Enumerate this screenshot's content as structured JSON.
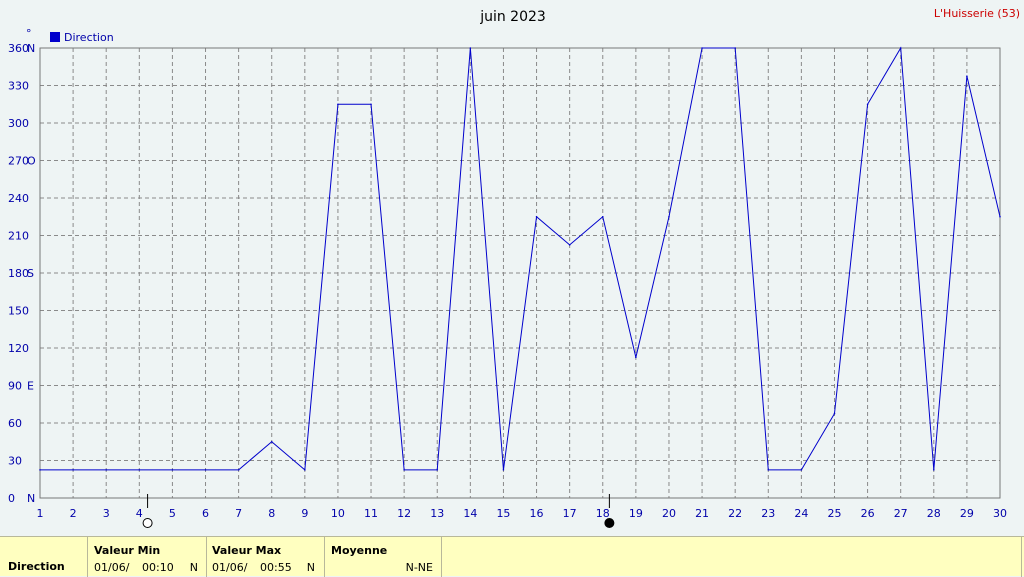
{
  "header": {
    "title": "juin 2023",
    "station": "L'Huisserie (53)",
    "unit_symbol": "°"
  },
  "colors": {
    "line": "#0000cc",
    "axis_text": "#0000aa",
    "title_text": "#000000",
    "station_text": "#cc0000",
    "grid": "#8a8a8a",
    "plot_background": "#eef4f4",
    "footer_background": "#ffffc0"
  },
  "chart_data": {
    "type": "line",
    "title": "juin 2023",
    "xlabel": "",
    "ylabel": "°",
    "xlim": [
      1,
      30
    ],
    "ylim": [
      0,
      360
    ],
    "grid": true,
    "legend_position": "top-left",
    "x_ticks": [
      "1",
      "2",
      "3",
      "4",
      "5",
      "6",
      "7",
      "8",
      "9",
      "10",
      "11",
      "12",
      "13",
      "14",
      "15",
      "16",
      "17",
      "18",
      "19",
      "20",
      "21",
      "22",
      "23",
      "24",
      "25",
      "26",
      "27",
      "28",
      "29",
      "30"
    ],
    "y_ticks": [
      {
        "value": 0,
        "label": "0",
        "cardinal": "N"
      },
      {
        "value": 30,
        "label": "30",
        "cardinal": ""
      },
      {
        "value": 60,
        "label": "60",
        "cardinal": ""
      },
      {
        "value": 90,
        "label": "90",
        "cardinal": "E"
      },
      {
        "value": 120,
        "label": "120",
        "cardinal": ""
      },
      {
        "value": 150,
        "label": "150",
        "cardinal": ""
      },
      {
        "value": 180,
        "label": "180",
        "cardinal": "S"
      },
      {
        "value": 210,
        "label": "210",
        "cardinal": ""
      },
      {
        "value": 240,
        "label": "240",
        "cardinal": ""
      },
      {
        "value": 270,
        "label": "270",
        "cardinal": "O"
      },
      {
        "value": 300,
        "label": "300",
        "cardinal": ""
      },
      {
        "value": 330,
        "label": "330",
        "cardinal": ""
      },
      {
        "value": 360,
        "label": "360",
        "cardinal": "N"
      }
    ],
    "series": [
      {
        "name": "Direction",
        "x": [
          1,
          2,
          3,
          4,
          5,
          6,
          7,
          8,
          9,
          10,
          11,
          12,
          13,
          14,
          15,
          16,
          17,
          18,
          19,
          20,
          21,
          22,
          23,
          24,
          25,
          26,
          27,
          28,
          29,
          30
        ],
        "values": [
          22.5,
          22.5,
          22.5,
          22.5,
          22.5,
          22.5,
          22.5,
          45,
          22.5,
          315,
          315,
          22.5,
          22.5,
          360,
          22.5,
          225,
          202.5,
          225,
          112.5,
          225,
          360,
          360,
          22.5,
          22.5,
          67.5,
          315,
          360,
          22.5,
          337.5,
          225
        ]
      }
    ],
    "moon_phases": [
      {
        "day": 4.25,
        "phase": "full"
      },
      {
        "day": 18.2,
        "phase": "new"
      }
    ]
  },
  "footer": {
    "row_label": "Direction",
    "min_header": "Valeur Min",
    "min_date": "01/06/",
    "min_time": "00:10",
    "min_dir": "N",
    "max_header": "Valeur Max",
    "max_date": "01/06/",
    "max_time": "00:55",
    "max_dir": "N",
    "avg_header": "Moyenne",
    "avg_value": "N-NE"
  }
}
